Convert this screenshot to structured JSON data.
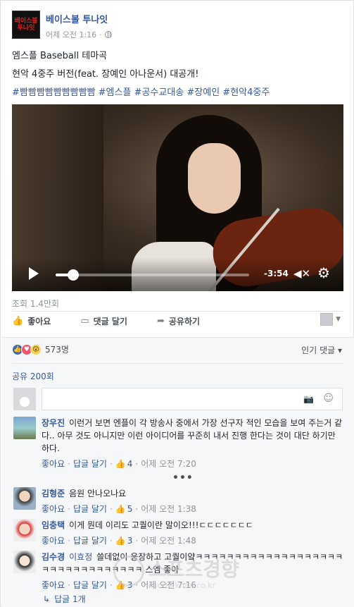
{
  "page": {
    "name": "베이스볼 투나잇",
    "time": "어제 오전 1:16",
    "logo_text": [
      "베이스볼",
      "투나잇"
    ]
  },
  "post": {
    "line1": "엠스플 Baseball 테마곡",
    "line2": "현악 4중주 버전(feat. 장예인 아나운서) 대공개!",
    "hashtags": "#빰빰빰빰빰빰빰빰빰 #엠스플 #공수교대송 #장예인 #현악4중주"
  },
  "video": {
    "time_remaining": "-3:54",
    "progress": 0.09,
    "play_icon": "play-icon",
    "mute_icon": "mute-icon",
    "settings_icon": "gear-icon"
  },
  "views": "조회 1.4만회",
  "actions": {
    "like": "좋아요",
    "comment": "댓글 달기",
    "share": "공유하기"
  },
  "reactions": {
    "count": "573명",
    "popular_label": "인기 댓글 ▾",
    "share_count": "공유 200회"
  },
  "comments": [
    {
      "name": "장우진",
      "text": "이런거 보면 엔플이 각 방송사 중에서 가장 선구자 적인 모습을 보여 주는거 같다.. 아무 것도 아니지만 이런 아이디어를 꾸준히 내서 진행 한다는 것이 대단 하기만 하다.",
      "like": "좋아요",
      "reply": "답글 달기",
      "likes": "4",
      "time": "어제 오전 7:20"
    },
    {
      "name": "김형준",
      "text": "음원 안나오나요",
      "like": "좋아요",
      "reply": "답글 달기",
      "likes": "5",
      "time": "어제 오전 1:38"
    },
    {
      "name": "임충택",
      "text": "이게 뭔데 이리도 고퀄이란 말이오!!!ㄷㄷㄷㄷㄷㄷㄷ",
      "like": "좋아요",
      "reply": "답글 달기",
      "likes": "3",
      "time": "어제 오전 1:48"
    },
    {
      "name": "김수경",
      "tag": "이효정",
      "text": "쓸데없이 웅장하고 고퀄이얔ㅋㅋㅋㅋㅋㅋㅋㅋㅋㅋㅋㅋㅋㅋㅋㅋㅋㅋㅋㅋㅋㅋㅋㅋㅋㅋㅋㅋㅋㅋㅋㅋ 스엠 좋아",
      "like": "좋아요",
      "reply": "답글 달기",
      "likes": "3",
      "time": "어제 오전 7:16"
    }
  ],
  "more_dots": "•••",
  "reply_count": "답글 1개",
  "watermark": {
    "main": "스포츠경향",
    "sub": "sports.khan.co.kr"
  }
}
